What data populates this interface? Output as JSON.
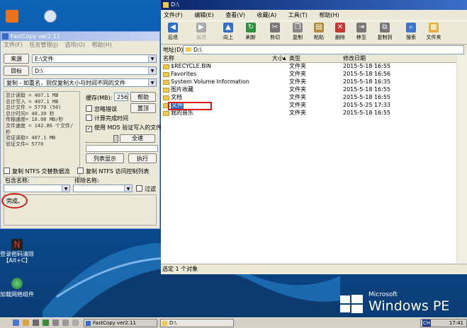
{
  "desktop": {
    "icons": [
      {
        "label": "登录密码清除\n【Alt+C】",
        "icon": "key-remover-icon"
      },
      {
        "label": "加载网络组件",
        "icon": "network-globe-icon"
      }
    ],
    "brand_small": "Microsoft",
    "brand_large": "Windows PE"
  },
  "fastcopy": {
    "title": "FastCopy ver2.11",
    "menu": [
      "文件(F)",
      "任务管理(J)",
      "选项(O)",
      "帮助(H)"
    ],
    "source_button": "来源",
    "source_path": "E:\\文件",
    "dest_button": "目标",
    "dest_path": "D:\\",
    "mode": "复制 - 如重名，则仅复制大小与时间不同的文件",
    "stats": [
      "总计读取 = 407.1 MB",
      "总计写入 = 407.1 MB",
      "总计文件 = 5770 (50)",
      "总计时间= 40.39 秒",
      "传输速度= 10.08 MB/秒",
      "文件速度 = 142.86 个文件/秒",
      "验证读取= 407.1 MB",
      "验证文件= 5770"
    ],
    "buffer_label": "缓存(MB):",
    "buffer_value": "256",
    "help_button": "帮助",
    "ignore_errors": "忽略错误",
    "top_button": "置顶",
    "estimate": "计算完成时间",
    "verify": "使用 MD5 验证写入的文件",
    "full_speed": "全速",
    "list_button": "列表显示",
    "exec_button": "执行",
    "ntfs_stream": "复制 NTFS 交替数据流",
    "ntfs_acl": "复制 NTFS 访问控制列表",
    "include_label": "包含名称:",
    "exclude_label": "排除名称:",
    "filter": "过滤",
    "status": "完成。"
  },
  "explorer": {
    "title": "D:\\",
    "menu": [
      "文件(F)",
      "编辑(E)",
      "查看(V)",
      "收藏(A)",
      "工具(T)",
      "帮助(H)"
    ],
    "toolbar": [
      "后退",
      "前进",
      "向上",
      "刷新",
      "剪切",
      "复制",
      "粘贴",
      "删除",
      "移至",
      "复制到",
      "搜索",
      "文件夹"
    ],
    "address_label": "地址(D)",
    "address": "D:\\",
    "columns": [
      "名称",
      "大小",
      "类型",
      "修改日期"
    ],
    "rows": [
      {
        "name": "$RECYCLE.BIN",
        "type": "文件夹",
        "date": "2015-5-18 16:55"
      },
      {
        "name": "Favorites",
        "type": "文件夹",
        "date": "2015-5-18 16:56"
      },
      {
        "name": "System Volume Information",
        "type": "文件夹",
        "date": "2015-5-18 16:35"
      },
      {
        "name": "图片收藏",
        "type": "文件夹",
        "date": "2015-5-18 16:55"
      },
      {
        "name": "文档",
        "type": "文件夹",
        "date": "2015-5-18 16:55"
      },
      {
        "name": "文件",
        "type": "文件夹",
        "date": "2015-5-25 17:33"
      },
      {
        "name": "我的音乐",
        "type": "文件夹",
        "date": "2015-5-18 16:55"
      }
    ],
    "status": "选定 1 个对象"
  },
  "taskbar": {
    "tasks": [
      "FastCopy ver2.11",
      "D:\\"
    ],
    "clock": "17:41",
    "tray_label": "CH"
  },
  "colors": {
    "accent": "#316ac5",
    "annotation": "#e0191b"
  }
}
